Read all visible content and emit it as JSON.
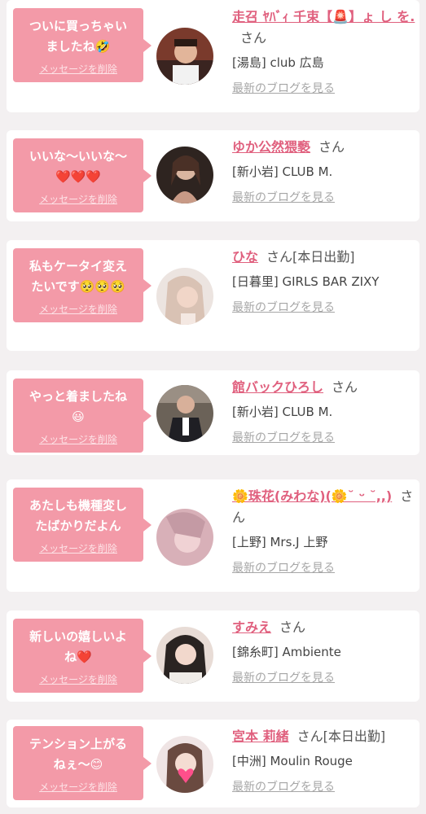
{
  "entries": [
    {
      "message": "ついに買っちゃい\nましたね🤣",
      "delete_label": "メッセージを削除",
      "name": "走召 ﾔﾊﾞｨ 千束【🚨】ょ し を.",
      "honorific": "さん",
      "status": "",
      "shop": "[湯島] club 広島",
      "blog_label": "最新のブログを見る"
    },
    {
      "message": "いいな〜いいな〜\n❤️❤️❤️",
      "delete_label": "メッセージを削除",
      "name": "ゆか公然猥褻",
      "honorific": "さん",
      "status": "",
      "shop": "[新小岩] CLUB M.",
      "blog_label": "最新のブログを見る"
    },
    {
      "message": "私もケータイ変え\nたいです🥺🥺🥺",
      "delete_label": "メッセージを削除",
      "name": "ひな",
      "honorific": "さん",
      "status": "[本日出勤]",
      "shop": "[日暮里] GIRLS BAR ZIXY",
      "blog_label": "最新のブログを見る"
    },
    {
      "message": "やっと着ましたね\n😃",
      "delete_label": "メッセージを削除",
      "name": "館バックひろし",
      "honorific": "さん",
      "status": "",
      "shop": "[新小岩] CLUB M.",
      "blog_label": "最新のブログを見る"
    },
    {
      "message": "あたしも機種変し\nたばかりだよん",
      "delete_label": "メッセージを削除",
      "name": "🌼珠花(みわな)(🌼˘ ᵕ ˘,,)",
      "honorific": "さん",
      "status": "",
      "shop": "[上野] Mrs.J 上野",
      "blog_label": "最新のブログを見る"
    },
    {
      "message": "新しいの嬉しいよ\nね❤️",
      "delete_label": "メッセージを削除",
      "name": "すみえ",
      "honorific": "さん",
      "status": "",
      "shop": "[錦糸町] Ambiente",
      "blog_label": "最新のブログを見る"
    },
    {
      "message": "テンション上がる\nねぇ〜😊",
      "delete_label": "メッセージを削除",
      "name": "宮本 莉緒",
      "honorific": "さん",
      "status": "[本日出勤]",
      "shop": "[中洲] Moulin Rouge",
      "blog_label": "最新のブログを見る"
    }
  ],
  "colors": {
    "bubble": "#f39aa8",
    "name": "#e0607e",
    "link_gray": "#a6a6a6",
    "background": "#f3f0f1"
  }
}
